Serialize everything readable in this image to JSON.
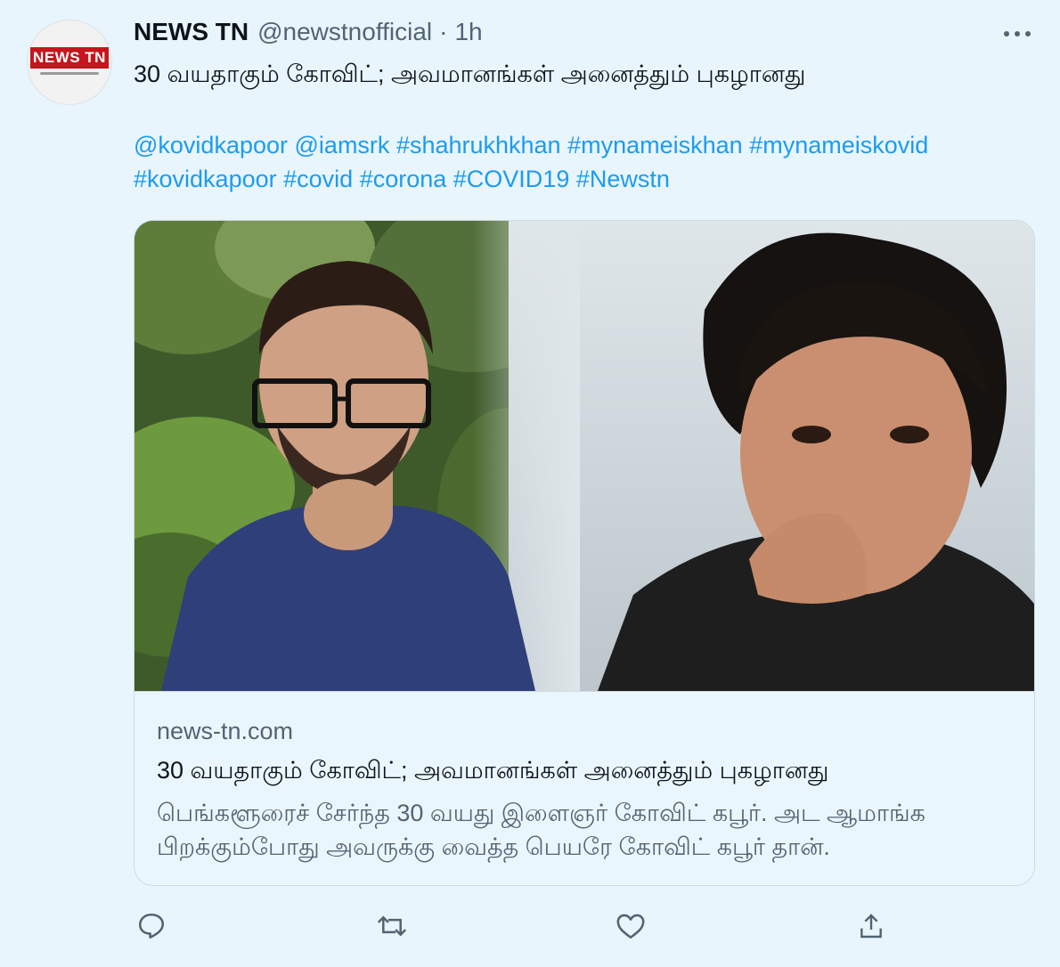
{
  "account": {
    "display_name": "NEWS TN",
    "handle": "@newstnofficial",
    "separator": "·",
    "timestamp": "1h",
    "avatar_logo_text": "NEWS TN"
  },
  "tweet": {
    "text": "30 வயதாகும் கோவிட்; அவமானங்கள் அனைத்தும் புகழானது",
    "tags": [
      "@kovidkapoor",
      "@iamsrk",
      "#shahrukhkhan",
      "#mynameiskhan",
      "#mynameiskovid",
      "#kovidkapoor",
      "#covid",
      "#corona",
      "#COVID19",
      "#Newstn"
    ]
  },
  "card": {
    "domain": "news-tn.com",
    "title": "30 வயதாகும் கோவிட்; அவமானங்கள் அனைத்தும் புகழானது",
    "description_line1": "பெங்களூரைச் சேர்ந்த 30 வயது இளைஞர் கோவிட் கபூர். அட ஆமாங்க",
    "description_line2": "பிறக்கும்போது அவருக்கு வைத்த பெயரே கோவிட் கபூர் தான்."
  },
  "actions": {
    "icons": [
      "reply-icon",
      "retweet-icon",
      "like-icon",
      "share-icon"
    ]
  },
  "colors": {
    "background": "#e8f5fd",
    "link": "#1d9bf0",
    "secondary_text": "#536471",
    "primary_text": "#0f1419",
    "logo_red": "#c4161c"
  }
}
